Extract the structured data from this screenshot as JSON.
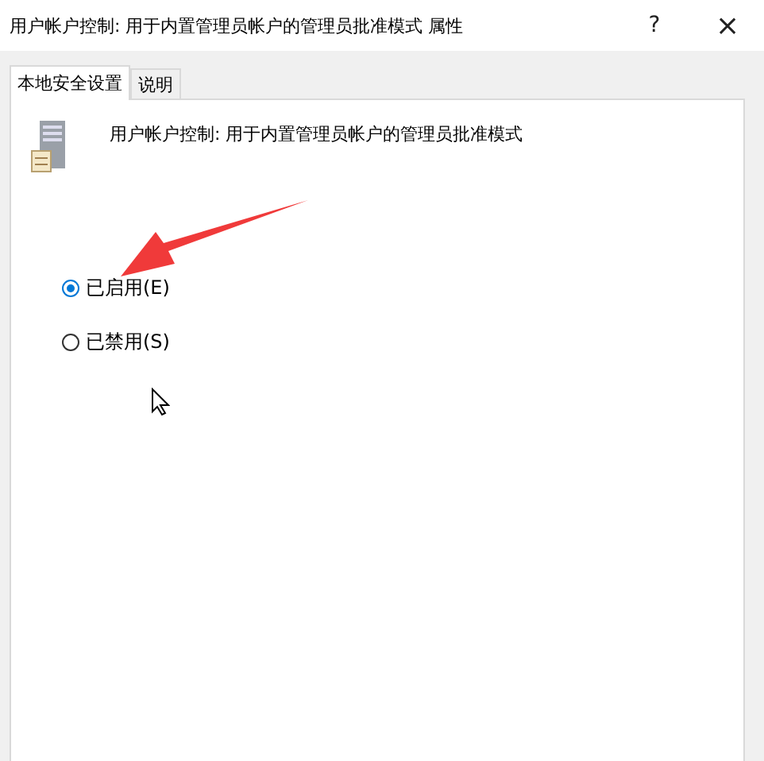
{
  "window": {
    "title": "用户帐户控制: 用于内置管理员帐户的管理员批准模式 属性",
    "help": "?",
    "close": "×"
  },
  "tabs": [
    {
      "label": "本地安全设置",
      "selected": true
    },
    {
      "label": "说明",
      "selected": false
    }
  ],
  "policy": {
    "name": "用户帐户控制: 用于内置管理员帐户的管理员批准模式"
  },
  "options": [
    {
      "label": "已启用(E)",
      "selected": true
    },
    {
      "label": "已禁用(S)",
      "selected": false
    }
  ]
}
